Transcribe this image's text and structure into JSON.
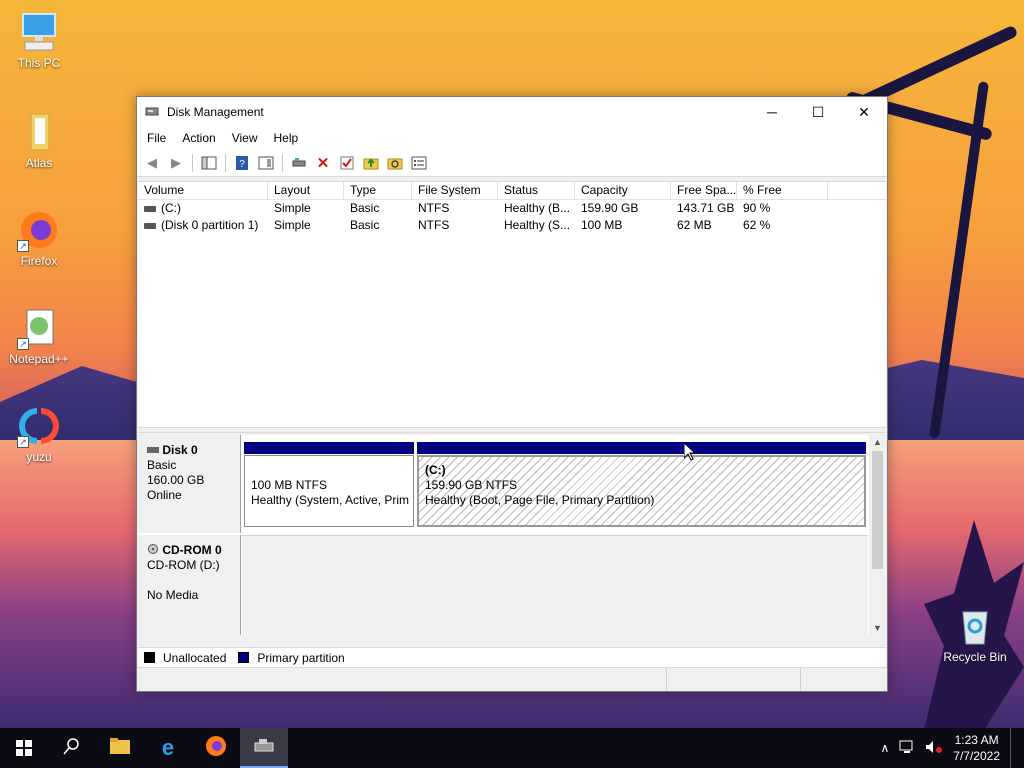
{
  "desktop": {
    "icons": [
      {
        "label": "This PC",
        "icon": "monitor-icon"
      },
      {
        "label": "Atlas",
        "icon": "folder-icon"
      },
      {
        "label": "Firefox",
        "icon": "firefox-icon"
      },
      {
        "label": "Notepad++",
        "icon": "notepad-icon"
      },
      {
        "label": "yuzu",
        "icon": "yuzu-icon"
      },
      {
        "label": "Recycle Bin",
        "icon": "recycle-bin-icon"
      }
    ]
  },
  "window": {
    "title": "Disk Management",
    "controls": {
      "minimize": "─",
      "maximize": "☐",
      "close": "✕"
    },
    "menu": [
      "File",
      "Action",
      "View",
      "Help"
    ]
  },
  "volume_table": {
    "columns": [
      "Volume",
      "Layout",
      "Type",
      "File System",
      "Status",
      "Capacity",
      "Free Spa...",
      "% Free"
    ],
    "rows": [
      [
        "(C:)",
        "Simple",
        "Basic",
        "NTFS",
        "Healthy (B...",
        "159.90 GB",
        "143.71 GB",
        "90 %"
      ],
      [
        "(Disk 0 partition 1)",
        "Simple",
        "Basic",
        "NTFS",
        "Healthy (S...",
        "100 MB",
        "62 MB",
        "62 %"
      ]
    ]
  },
  "disks": {
    "disk0": {
      "name": "Disk 0",
      "type": "Basic",
      "size": "160.00 GB",
      "state": "Online",
      "partition1": {
        "size": "100 MB NTFS",
        "status": "Healthy (System, Active, Prim"
      },
      "partition2": {
        "name": "(C:)",
        "size": "159.90 GB NTFS",
        "status": "Healthy (Boot, Page File, Primary Partition)"
      }
    },
    "cdrom0": {
      "name": "CD-ROM 0",
      "drive": "CD-ROM (D:)",
      "media": "No Media"
    }
  },
  "legend": {
    "unallocated": "Unallocated",
    "primary": "Primary partition",
    "unallocated_color": "#000000",
    "primary_color": "#000080"
  },
  "taskbar": {
    "time": "1:23 AM",
    "date": "7/7/2022"
  }
}
